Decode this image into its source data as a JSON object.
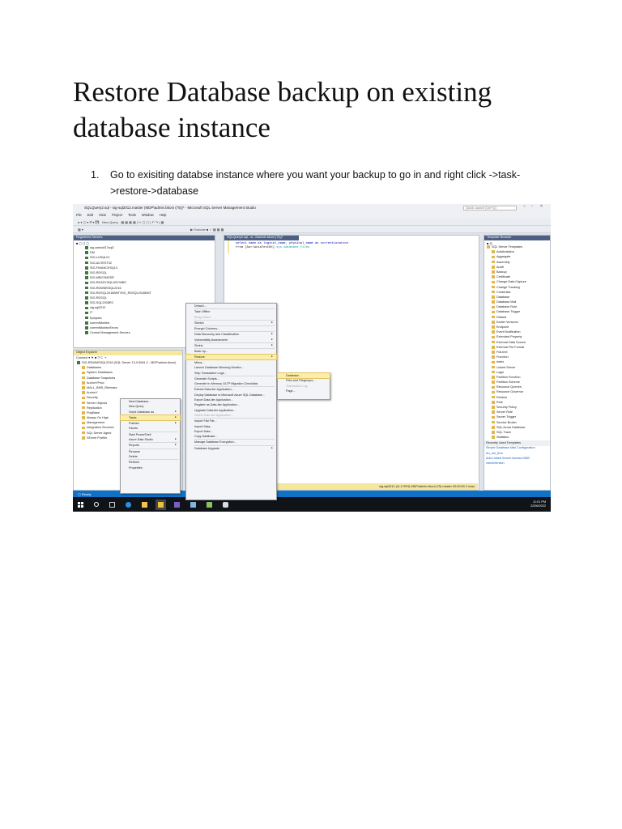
{
  "doc": {
    "title": "Restore Database backup on existing database instance",
    "step_number": "1.",
    "step_text": "Go to exisiting databse instance where you want your backup to go in and right click ->task->restore->database"
  },
  "ssms": {
    "window_title": "SQLQuery2.sql - sig-sql2012.master (MDP\\admin.bkoni (75))* - Microsoft SQL Server Management Studio",
    "quick_launch": "Quick Launch (Ctrl+Q)",
    "menu": [
      "File",
      "Edit",
      "View",
      "Project",
      "Tools",
      "Window",
      "Help"
    ],
    "toolbar_new_query": "New Query",
    "toolbar_execute": "Execute",
    "registered_servers": {
      "title": "Registered Servers",
      "items": [
        "sig-cantodl17sql2",
        "DM",
        "SIG-LUSQL01",
        "SIG-AUTEST02",
        "SIG-FINANCESQL0",
        "SIG-RDSQL",
        "SIG-MBCSMSSR",
        "SIG-RDASYSQLASYWBS",
        "SIG-RDWMSSQL2016",
        "SIG-RDSQL2016BNT\\SIG_RDSQL2016BNT",
        "SIG-RDSQL",
        "SIG-SQL2008R2",
        "sig-sql2012",
        "IT",
        "Epiqvalo",
        "currentMonitor",
        "currentMonitorErrors",
        "Central Management Servers"
      ]
    },
    "editor": {
      "tab": "SQLQuery2.sql - si...0\\admin.bkoni (75))*",
      "line1": "select name as logical_name, physical_name as currentLocation",
      "line2_a": "from [AurlaniaTestDb]",
      "line2_b": ".sys.database_files",
      "status": "sig-sql2012 (11.0 SP4)   MDP\\admin.bkoni (75)   master   00:00:00   2 rows"
    },
    "object_explorer": {
      "title": "Object Explorer",
      "connect": "Connect ▾",
      "server": "SIG-RDWMSSQL2016 (SQL Server 13.0.5081.2 - MDP\\admin.bkoni)",
      "items": [
        "Databases",
        "System Databases",
        "Database Snapshots",
        "AurionYProd",
        "MALL_BMS_Relrease",
        "AurionY",
        "Security",
        "Server Objects",
        "Replication",
        "PolyBase",
        "Always On High",
        "Management",
        "Integration Services",
        "SQL Server Agent",
        "XEvent Profiler"
      ]
    },
    "db_menu": [
      "New Database...",
      "New Query",
      "Script Database as",
      "Tasks",
      "Policies",
      "Facets",
      "Start PowerShell",
      "Azure Data Studio",
      "Reports",
      "Rename",
      "Delete",
      "Refresh",
      "Properties"
    ],
    "tasks_menu": [
      "Detach...",
      "Take Offline",
      "Bring Online",
      "Stretch",
      "Encrypt Columns...",
      "Data Discovery and Classification",
      "Vulnerability Assessment",
      "Shrink",
      "Back Up...",
      "Restore",
      "Mirror...",
      "Launch Database Mirroring Monitor...",
      "Ship Transaction Logs...",
      "Generate Scripts...",
      "Generate In-Memory OLTP Migration Checklists",
      "Extract Data-tier Application...",
      "Deploy Database to Microsoft Azure SQL Database...",
      "Export Data-tier Application...",
      "Register as Data-tier Application...",
      "Upgrade Data-tier Application...",
      "Delete Data-tier Application...",
      "Import Flat File...",
      "Import Data...",
      "Export Data...",
      "Copy Database...",
      "Manage Database Encryption...",
      "Database Upgrade"
    ],
    "restore_menu": [
      "Database...",
      "Files and Filegroups...",
      "Transaction Log...",
      "Page..."
    ],
    "template_browser": {
      "title": "Template Browser",
      "root": "SQL Server Templates",
      "items": [
        "AdaAnalytics",
        "Aggregate",
        "Assembly",
        "Audit",
        "Backup",
        "Certificate",
        "Change Data Capture",
        "Change Tracking",
        "Credential",
        "Database",
        "Database Mail",
        "Database Role",
        "Database Trigger",
        "Default",
        "Earlier Versions",
        "Endpoint",
        "Event Notification",
        "Extended Property",
        "External Data Source",
        "External File Format",
        "Full-text",
        "Function",
        "Index",
        "Linked Server",
        "Login",
        "Partition Function",
        "Partition Scheme",
        "Resource Queries",
        "Resource Governor",
        "Restore",
        "Role",
        "Security Policy",
        "Server Role",
        "Server Trigger",
        "Service Broker",
        "SQL Azure Database",
        "SQL Trace",
        "Statistics"
      ],
      "recent_title": "Recently Used Templates",
      "recent": [
        "Simple Database Mail Configuration",
        "Au_run_thru",
        "Add Linked Server Access MDB",
        "checkVersion"
      ]
    },
    "status_ready": "Ready",
    "clock_time": "11:01 PM",
    "clock_date": "22/06/2022"
  }
}
